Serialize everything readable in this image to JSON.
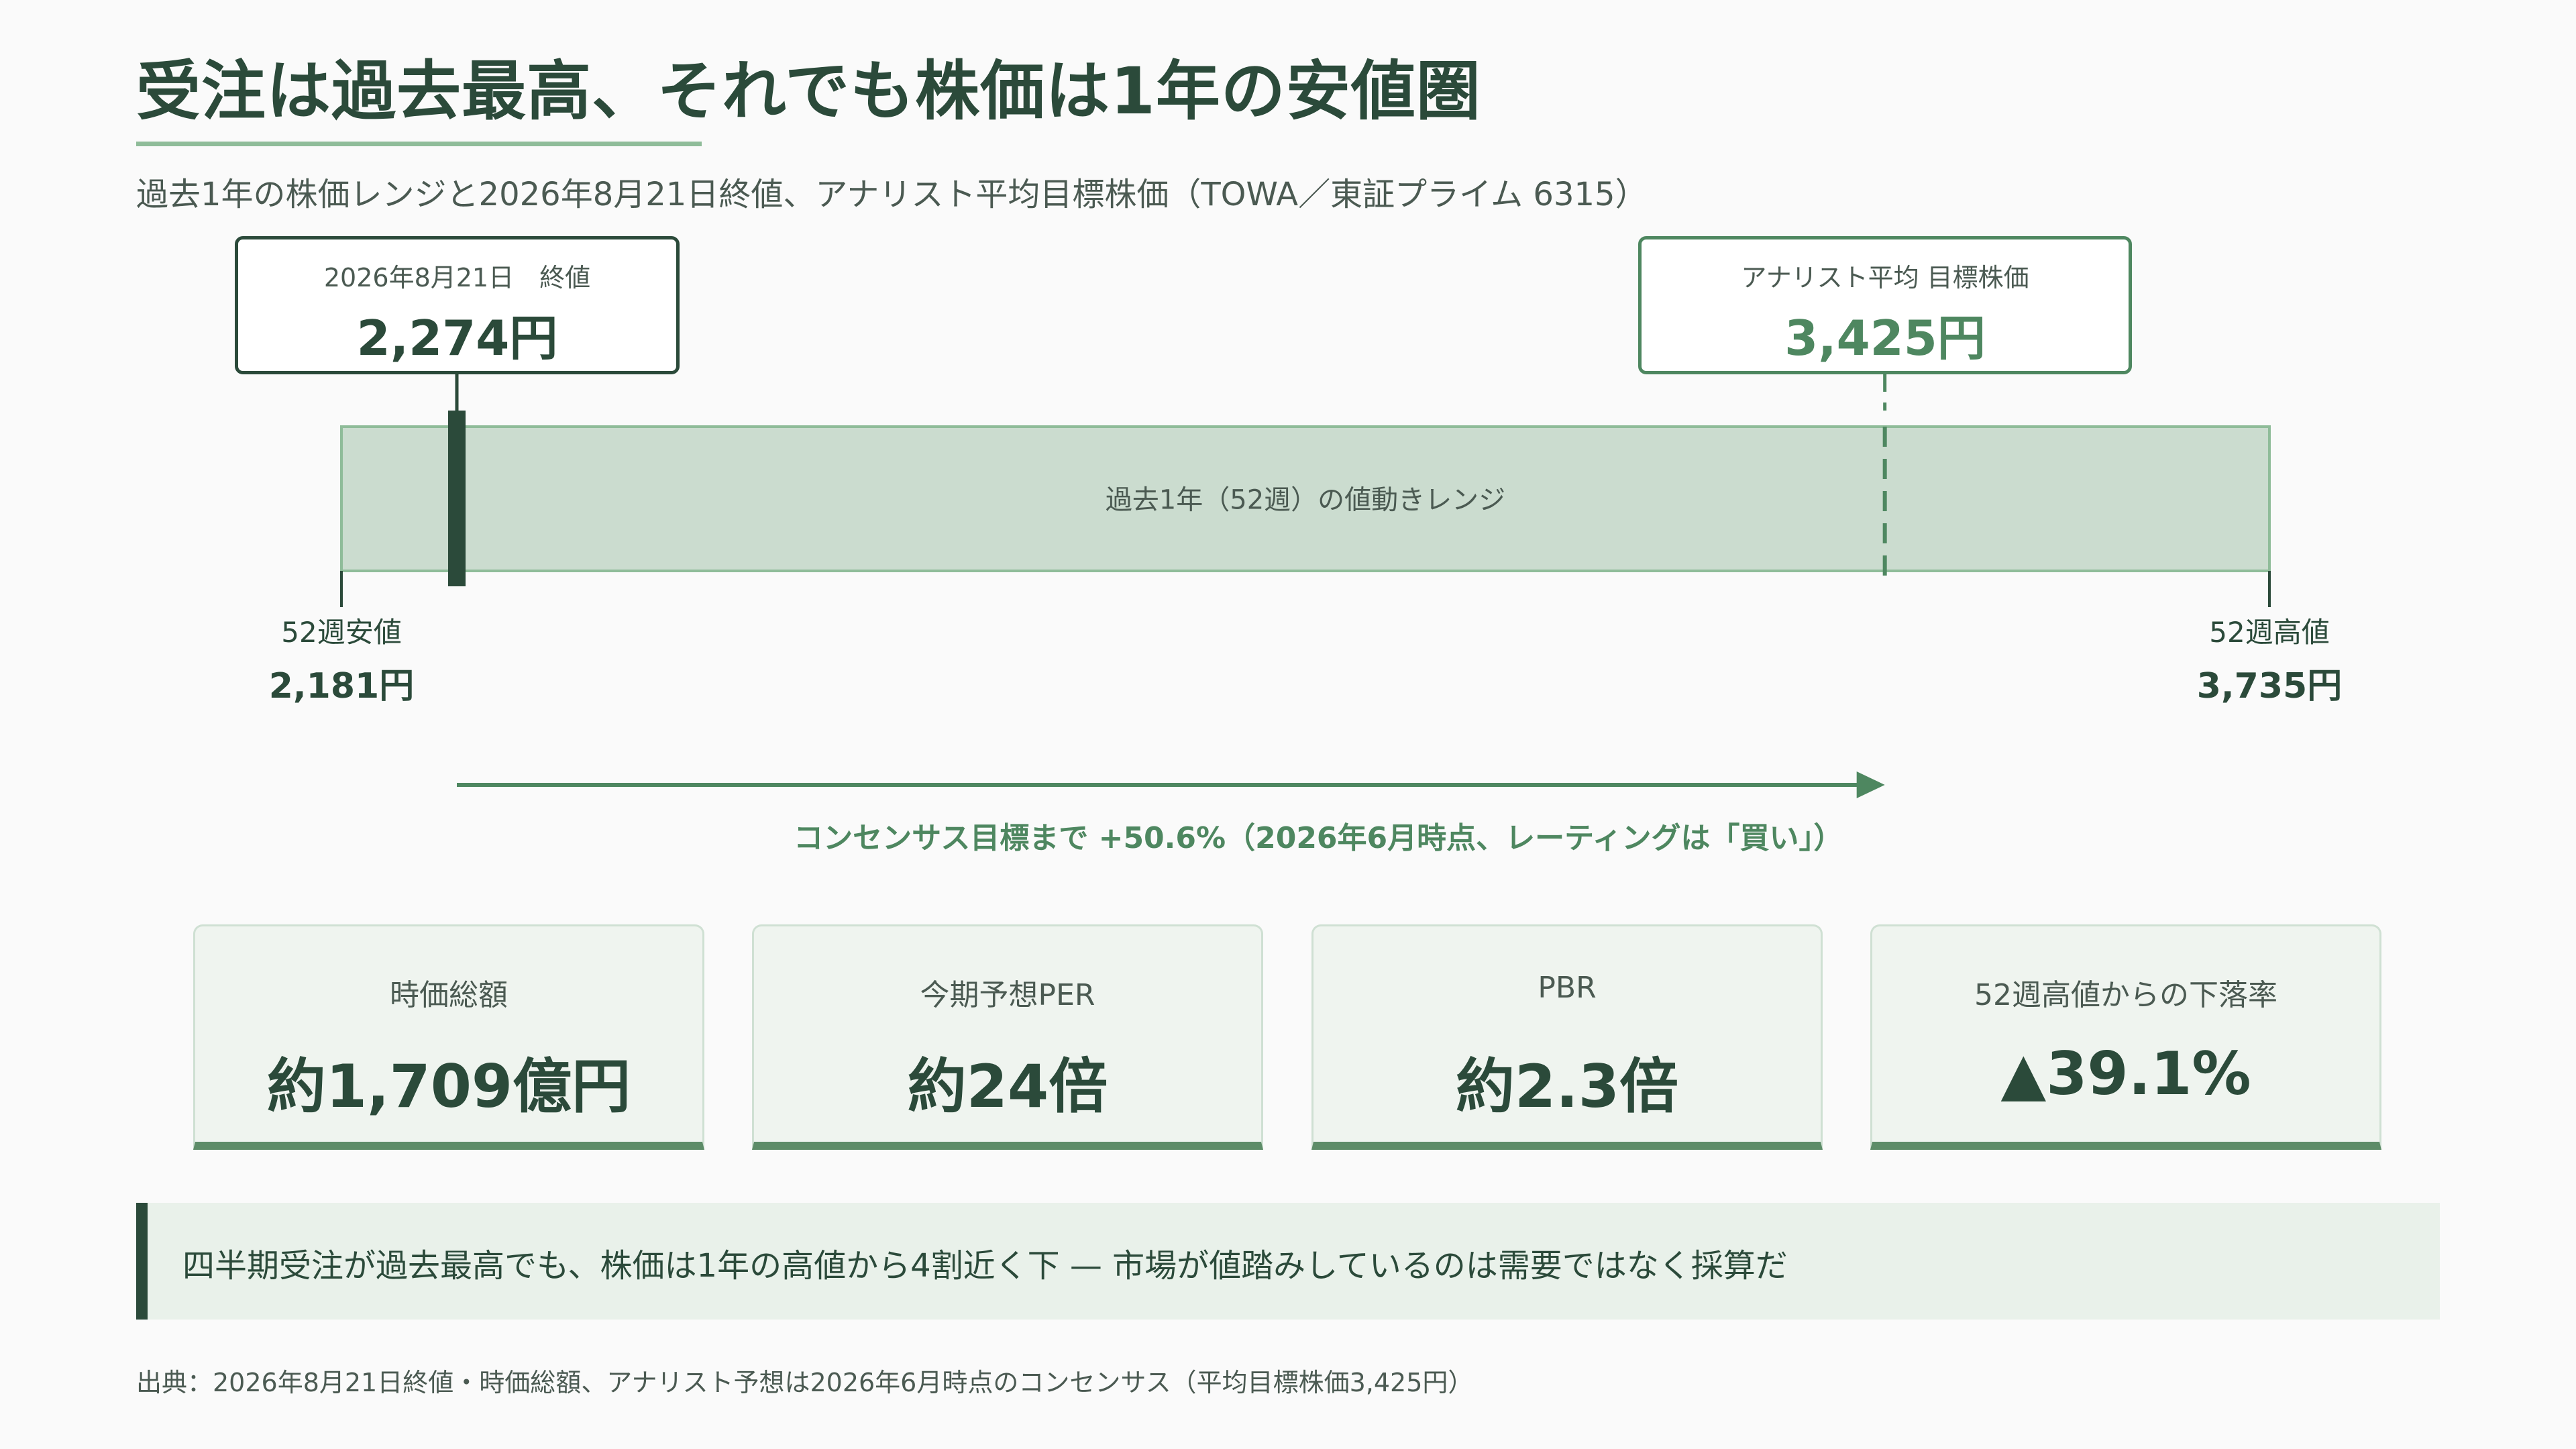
{
  "header": {
    "title": "受注は過去最高、それでも株価は1年の安値圏",
    "subtitle": "過去1年の株価レンジと2026年8月21日終値、アナリスト平均目標株価（TOWA／東証プライム 6315）"
  },
  "callouts": {
    "close": {
      "label": "2026年8月21日　終値",
      "value": "2,274円"
    },
    "target": {
      "label": "アナリスト平均 目標株価",
      "value": "3,425円"
    }
  },
  "chart_data": {
    "type": "range",
    "unit": "円",
    "range_label": "過去1年（52週）の値動きレンジ",
    "low": {
      "label": "52週安値",
      "value": 2181,
      "value_label": "2,181円"
    },
    "high": {
      "label": "52週高値",
      "value": 3735,
      "value_label": "3,735円"
    },
    "close": {
      "value": 2274
    },
    "target": {
      "value": 3425
    },
    "upside_label": "コンセンサス目標まで +50.6%（2026年6月時点、レーティングは「買い」）"
  },
  "metrics": [
    {
      "label": "時価総額",
      "value": "約1,709億円"
    },
    {
      "label": "今期予想PER",
      "value": "約24倍"
    },
    {
      "label": "PBR",
      "value": "約2.3倍"
    },
    {
      "label": "52週高値からの下落率",
      "value": "▲39.1%"
    }
  ],
  "takeaway": "四半期受注が過去最高でも、株価は1年の高値から4割近く下 — 市場が値踏みしているのは需要ではなく採算だ",
  "source": "出典：2026年8月21日終値・時価総額、アナリスト予想は2026年6月時点のコンセンサス（平均目標株価3,425円）",
  "colors": {
    "dark_green": "#2b4a3a",
    "accent_green": "#4e8760",
    "range_fill": "#cbdccf",
    "range_stroke": "#8fbc99"
  }
}
